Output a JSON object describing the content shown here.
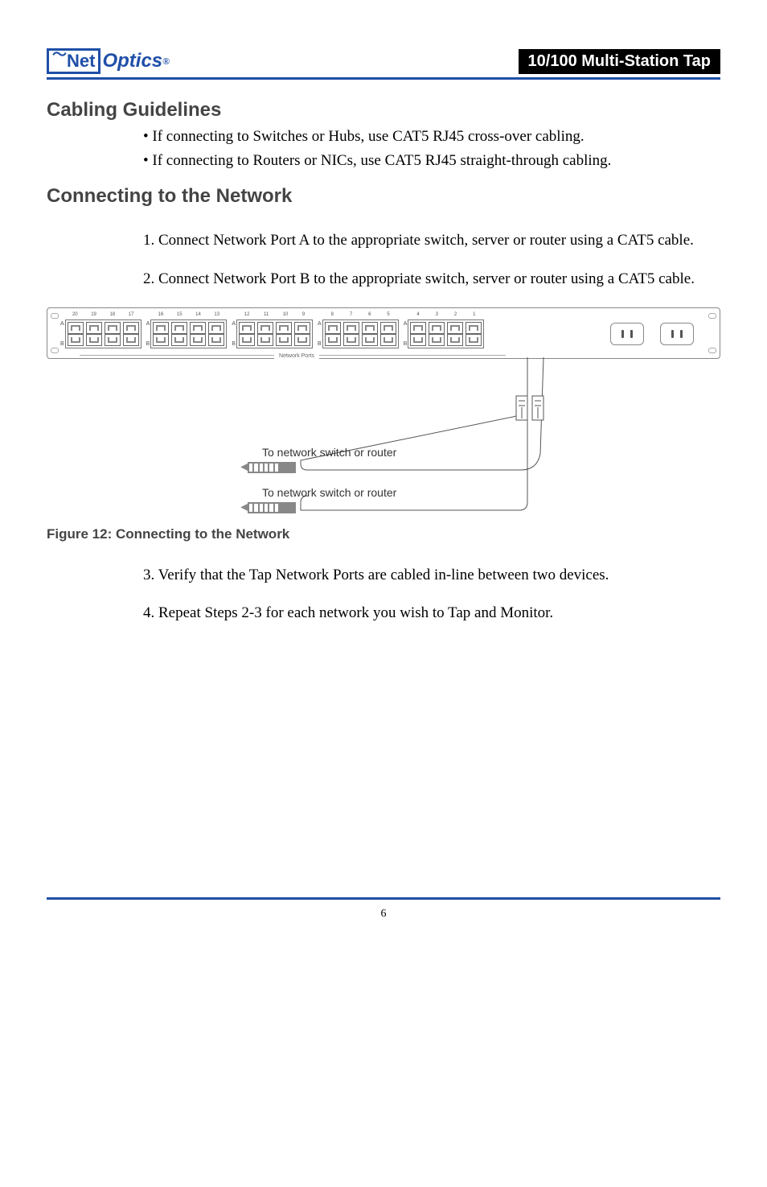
{
  "header": {
    "logo_net": "Net",
    "logo_optics": "Optics",
    "logo_reg": "®",
    "title_bar": "10/100 Multi-Station Tap"
  },
  "sections": {
    "cabling_guidelines": {
      "heading": "Cabling Guidelines",
      "bullets": [
        "If connecting to Switches or Hubs, use CAT5 RJ45 cross-over cabling.",
        "If connecting to Routers or NICs, use CAT5 RJ45 straight-through cabling."
      ]
    },
    "connecting_network": {
      "heading": "Connecting to the Network",
      "steps_before_figure": [
        "Connect Network Port A to the appropriate switch, server or router using a CAT5 cable.",
        "Connect Network Port B to the appropriate switch, server or router using a CAT5 cable."
      ],
      "steps_after_figure": [
        "Verify that the Tap Network Ports are cabled in-line between two devices.",
        "Repeat Steps 2-3 for each network you wish to Tap and Monitor."
      ]
    }
  },
  "figure": {
    "port_numbers": [
      [
        "20",
        "19",
        "18",
        "17"
      ],
      [
        "16",
        "15",
        "14",
        "13"
      ],
      [
        "12",
        "11",
        "10",
        "9"
      ],
      [
        "8",
        "7",
        "6",
        "5"
      ],
      [
        "4",
        "3",
        "2",
        "1"
      ]
    ],
    "row_labels": {
      "top": "A",
      "bottom": "B"
    },
    "network_ports_label": "Network Ports",
    "cable_label_1": "To network switch or router",
    "cable_label_2": "To network switch or router",
    "caption_number": "Figure 12:",
    "caption_title": "Connecting to the Network"
  },
  "footer": {
    "page_number": "6"
  }
}
